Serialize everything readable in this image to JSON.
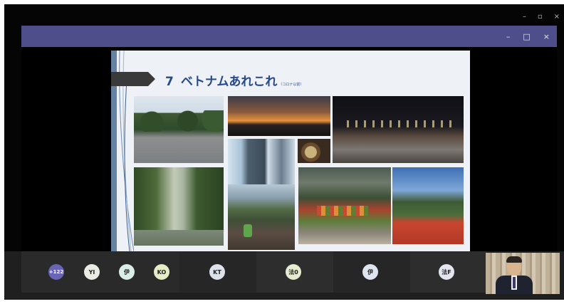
{
  "window": {
    "outer_controls": {
      "minimize": "–",
      "restore": "▫",
      "close": "×"
    },
    "inner_controls": {
      "minimize": "–",
      "maximize": "□",
      "close": "×"
    },
    "inner_bar_color": "#4e4e8a"
  },
  "slide": {
    "number": "7",
    "title": "ベトナムあれこれ",
    "subtitle": "（コロナ以前）",
    "title_color": "#274a8a",
    "photos": [
      "photo-park-road",
      "photo-sunset-skyline",
      "photo-night-traffic",
      "photo-skyscrapers",
      "photo-food-dish",
      "photo-motorbike-street",
      "photo-tree-lined-path",
      "photo-fruit-market",
      "photo-flower-bed"
    ]
  },
  "participants": {
    "overflow_count": "+122",
    "avatars": [
      {
        "initials": "YI",
        "color": "#e8ece4"
      },
      {
        "initials": "伊",
        "color": "#d8eee7"
      },
      {
        "initials": "KO",
        "color": "#e5ecc6"
      },
      {
        "initials": "KT",
        "color": "#dde2ea"
      },
      {
        "initials": "法0",
        "color": "#e6ecd0"
      },
      {
        "initials": "伊",
        "color": "#dfe5f0"
      },
      {
        "initials": "法F",
        "color": "#e4e6ef"
      }
    ],
    "overflow_color": "#6a64b5"
  }
}
